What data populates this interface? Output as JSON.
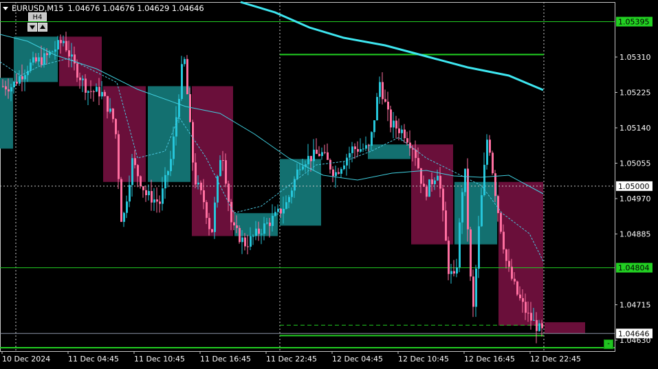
{
  "header": {
    "symbol": "EURUSD,M15",
    "open": "1.04676",
    "high": "1.04676",
    "low": "1.04629",
    "close": "1.04646"
  },
  "controls": {
    "higher_tf_label": "H4",
    "status_label": "-"
  },
  "price_scale": {
    "ticks": [
      "1.05310",
      "1.05225",
      "1.05140",
      "1.05055",
      "1.04970",
      "1.04885",
      "1.04715",
      "1.04630"
    ],
    "level_tags": [
      {
        "label": "1.05395",
        "price": 1.05395,
        "style": "green",
        "role": "horizontal-level"
      },
      {
        "label": "1.05000",
        "price": 1.05,
        "style": "white",
        "role": "round-level"
      },
      {
        "label": "1.04804",
        "price": 1.04804,
        "style": "green",
        "role": "horizontal-level"
      },
      {
        "label": "1.04646",
        "price": 1.04646,
        "style": "white",
        "role": "current-price"
      }
    ]
  },
  "time_scale": {
    "labels": [
      "10 Dec 2024",
      "11 Dec 04:45",
      "11 Dec 10:45",
      "11 Dec 16:45",
      "11 Dec 22:45",
      "12 Dec 04:45",
      "12 Dec 10:45",
      "12 Dec 16:45",
      "12 Dec 22:45"
    ]
  },
  "colors": {
    "background": "#000000",
    "bull_candle": "#26c6da",
    "bear_candle": "#ff6fa0",
    "htf_bull_box": "#137070",
    "htf_bear_box": "#6a0f3a",
    "level_line": "#22d022",
    "slow_ma": "#3ee6f0",
    "fast_ma": "#40d0e0",
    "text": "#ffffff"
  }
}
